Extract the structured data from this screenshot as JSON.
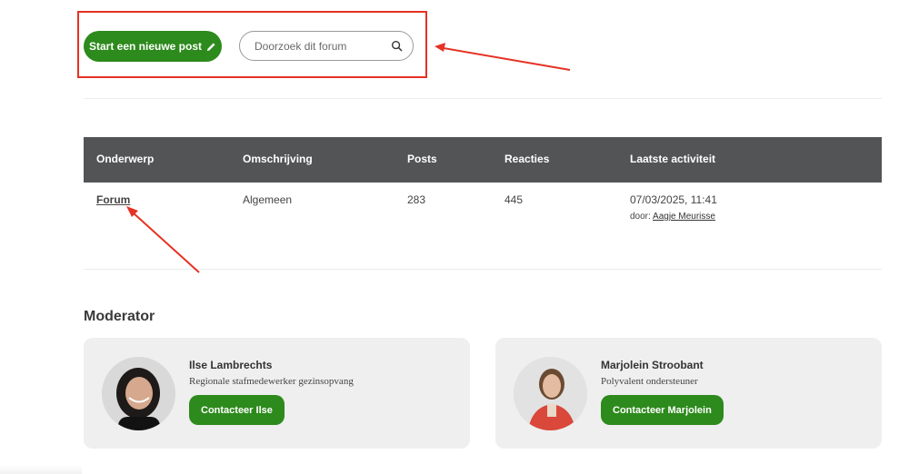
{
  "toolbar": {
    "new_post_label": "Start een nieuwe post",
    "search_placeholder": "Doorzoek dit forum"
  },
  "table": {
    "headers": [
      "Onderwerp",
      "Omschrijving",
      "Posts",
      "Reacties",
      "Laatste activiteit"
    ],
    "rows": [
      {
        "topic": "Forum",
        "description": "Algemeen",
        "posts": "283",
        "replies": "445",
        "last_activity": "07/03/2025, 11:41",
        "by_label": "door:",
        "by_user": "Aagje Meurisse"
      }
    ]
  },
  "moderators": {
    "heading": "Moderator",
    "items": [
      {
        "name": "Ilse Lambrechts",
        "role": "Regionale stafmedewerker gezinsopvang",
        "contact_label": "Contacteer Ilse"
      },
      {
        "name": "Marjolein Stroobant",
        "role": "Polyvalent ondersteuner",
        "contact_label": "Contacteer Marjolein"
      }
    ]
  },
  "colors": {
    "accent": "#2d8a1c",
    "table_header": "#525456",
    "annotation": "#e53224",
    "card_bg": "#efefef"
  },
  "icons": {
    "new_post": "pencil-icon",
    "search": "search-icon"
  }
}
